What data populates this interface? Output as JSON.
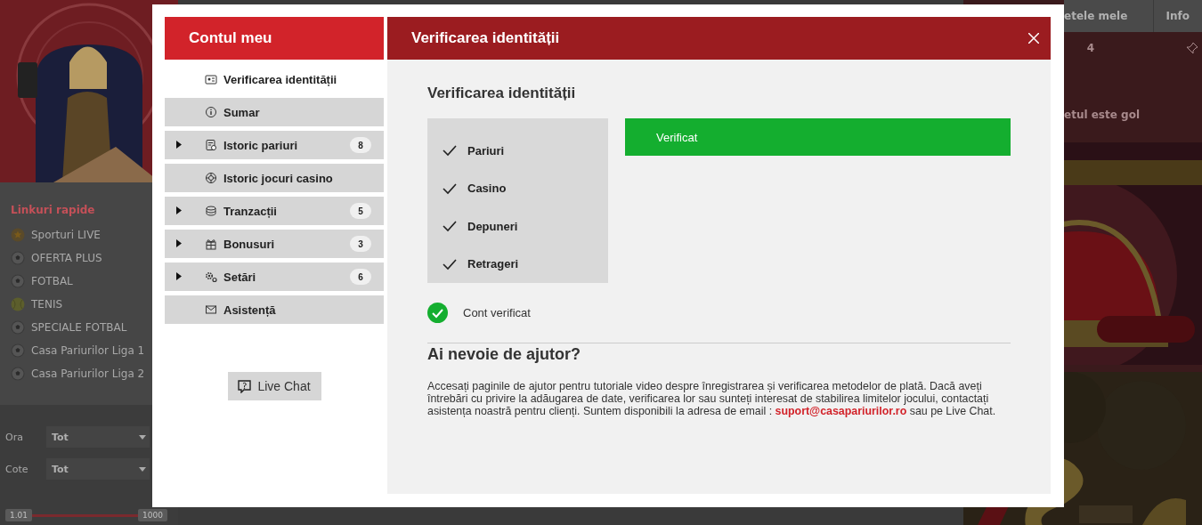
{
  "background": {
    "quick_links": {
      "title": "Linkuri rapide",
      "items": [
        {
          "label": "Sporturi LIVE",
          "kind": "live"
        },
        {
          "label": "OFERTA PLUS",
          "kind": "football"
        },
        {
          "label": "FOTBAL",
          "kind": "football"
        },
        {
          "label": "TENIS",
          "kind": "tennis"
        },
        {
          "label": "SPECIALE FOTBAL",
          "kind": "football"
        },
        {
          "label": "Casa Pariurilor Liga 1",
          "kind": "football"
        },
        {
          "label": "Casa Pariurilor Liga 2",
          "kind": "football"
        }
      ]
    },
    "filters": [
      {
        "label": "Ora",
        "value": "Tot"
      },
      {
        "label": "Cote",
        "value": "Tot"
      }
    ],
    "odds_range": {
      "min": "1.01",
      "max": "1000"
    },
    "right_tabs": [
      "etele mele",
      "Info"
    ],
    "tab_row": [
      "4"
    ],
    "betslip_message": "etul este gol"
  },
  "modal": {
    "sidebar_title": "Contul meu",
    "menu": [
      {
        "label": "Verificarea identității",
        "kind": "id-card",
        "expandable": false,
        "selected": true
      },
      {
        "label": "Sumar",
        "kind": "info",
        "expandable": false,
        "selected": false
      },
      {
        "label": "Istoric pariuri",
        "kind": "ticket",
        "expandable": true,
        "badge": "8",
        "selected": false
      },
      {
        "label": "Istoric jocuri casino",
        "kind": "chip",
        "expandable": false,
        "selected": false
      },
      {
        "label": "Tranzacții",
        "kind": "coins",
        "expandable": true,
        "badge": "5",
        "selected": false
      },
      {
        "label": "Bonusuri",
        "kind": "gift",
        "expandable": true,
        "badge": "3",
        "selected": false
      },
      {
        "label": "Setări",
        "kind": "gears",
        "expandable": true,
        "badge": "6",
        "selected": false
      },
      {
        "label": "Asistență",
        "kind": "mail",
        "expandable": false,
        "selected": false
      }
    ],
    "live_chat": "Live Chat",
    "title": "Verificarea identității",
    "section_title": "Verificarea identității",
    "checks": [
      {
        "label": "Pariuri",
        "checked": true
      },
      {
        "label": "Casino",
        "checked": true
      },
      {
        "label": "Depuneri",
        "checked": true
      },
      {
        "label": "Retrageri",
        "checked": true
      }
    ],
    "status": "Verificat",
    "account_status": {
      "label": "Cont verificat",
      "verified": true
    },
    "help_title": "Ai nevoie de ajutor?",
    "help_text": {
      "before": "Accesați paginile de ajutor pentru tutoriale video despre înregistrarea și verificarea metodelor de plată. Dacă aveți întrebări cu privire la adăugarea de date, verificarea lor sau sunteți interesat de stabilirea limitelor jocului, contactați asistența noastră pentru clienți. Suntem disponibili la adresa de email : ",
      "link": "suport@casapariurilor.ro",
      "after": " sau pe Live Chat."
    }
  }
}
